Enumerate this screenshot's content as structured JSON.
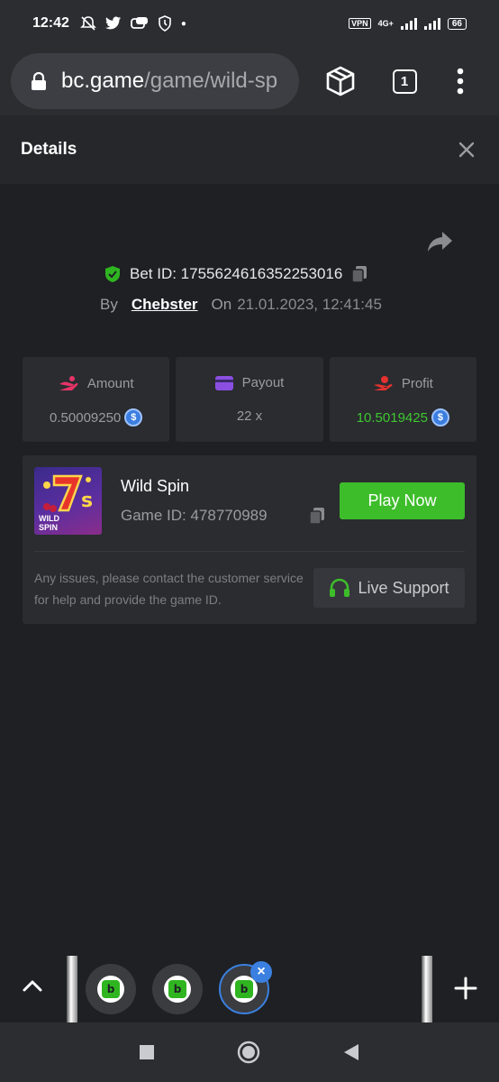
{
  "status_bar": {
    "time": "12:42",
    "vpn": "VPN",
    "network": "4G+",
    "battery": "66"
  },
  "browser": {
    "url_host": "bc.game",
    "url_path": "/game/wild-sp",
    "tab_count": "1"
  },
  "details": {
    "title": "Details"
  },
  "bet": {
    "bet_id": "Bet ID: 1755624616352253016",
    "by_label": "By",
    "user": "Chebster",
    "on_label": "On",
    "date": "21.01.2023, 12:41:45"
  },
  "stats": [
    {
      "label": "Amount",
      "value": "0.50009250",
      "icon": "amount-icon"
    },
    {
      "label": "Payout",
      "value": "22 x",
      "icon": "payout-card-icon"
    },
    {
      "label": "Profit",
      "value": "10.5019425",
      "icon": "profit-hand-icon"
    }
  ],
  "currency_symbol": "$",
  "game": {
    "name": "Wild Spin",
    "game_id": "Game ID: 478770989",
    "play_label": "Play Now",
    "thumb_text": "WILD SPIN",
    "support_text": "Any issues, please contact the customer service for help and provide the game ID.",
    "support_label": "Live Support"
  },
  "colors": {
    "accent_green": "#3dbd2a",
    "profit_green": "#3fc72f",
    "coin_blue": "#3b7ee0",
    "background": "#1e2024",
    "card": "#2a2c30"
  }
}
